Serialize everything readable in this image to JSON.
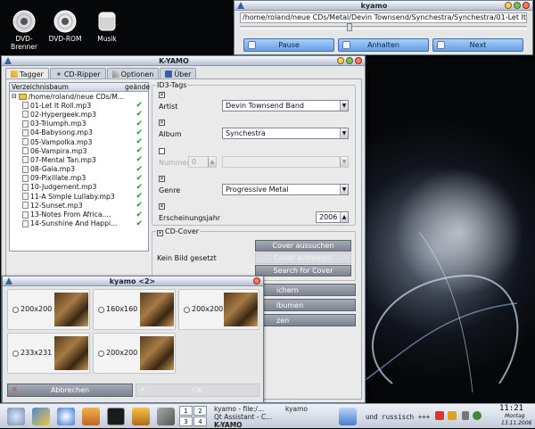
{
  "desktop": {
    "icons": [
      {
        "label": "DVD-\nBrenner",
        "icon": "dvd-burner-icon"
      },
      {
        "label": "DVD-ROM",
        "icon": "dvd-rom-icon"
      },
      {
        "label": "Musik",
        "icon": "music-drive-icon"
      }
    ]
  },
  "player": {
    "title": "kyamo",
    "path": "/home/roland/neue CDs/Metal/Devin Townsend/Synchestra/Synchestra/01-Let It Roll.mp3",
    "progress": 0.38,
    "buttons": {
      "pause": "Pause",
      "stop": "Anhalten",
      "next": "Next"
    }
  },
  "main": {
    "title": "K-YAMO",
    "tabs": [
      "Tagger",
      "CD-Ripper",
      "Optionen",
      "Über"
    ],
    "tree": {
      "col_dir": "Verzeichnisbaum",
      "col_changed": "geände",
      "root": "/home/roland/neue CDs/M...",
      "files": [
        "01-Let It Roll.mp3",
        "02-Hypergeek.mp3",
        "03-Triumph.mp3",
        "04-Babysong.mp3",
        "05-Vampolka.mp3",
        "06-Vampira.mp3",
        "07-Mental Tan.mp3",
        "08-Gaia.mp3",
        "09-Pixillate.mp3",
        "10-Judgement.mp3",
        "11-A Simple Lullaby.mp3",
        "12-Sunset.mp3",
        "13-Notes From Africa....",
        "14-Sunshine And Happi..."
      ]
    },
    "id3": {
      "group_title": "ID3-Tags",
      "artist_label": "Artist",
      "artist_value": "Devin Townsend Band",
      "album_label": "Album",
      "album_value": "Synchestra",
      "number_label": "Nummer",
      "number_value": "0",
      "genre_label": "Genre",
      "genre_value": "Progressive Metal",
      "year_label": "Erscheinungsjahr",
      "year_value": "2006"
    },
    "cover": {
      "group_title": "CD-Cover",
      "status": "Kein Bild gesetzt",
      "btn_search": "Cover aussuchen",
      "btn_remove": "Cover entfernen",
      "btn_find": "Search for Cover"
    },
    "side_buttons": [
      "ichern",
      "lbumen",
      "zen"
    ]
  },
  "dialog": {
    "title": "kyamo <2>",
    "sizes": [
      "200x200",
      "160x160",
      "200x200",
      "233x231",
      "200x200"
    ],
    "cancel": "Abbrechen",
    "ok": "OK"
  },
  "taskbar": {
    "pager": [
      "1",
      "2",
      "3",
      "4"
    ],
    "tasks": [
      "kyamo - file:/...",
      "kyamo",
      "Qt Assistant - C...",
      "K-YAMO"
    ],
    "ticker": "und russisch +++",
    "clock_time": "11:21",
    "clock_day": "Montag",
    "clock_date": "13.11.2006"
  },
  "colors": {
    "accent": "#6a9ee2",
    "check": "#1a9a2a"
  }
}
